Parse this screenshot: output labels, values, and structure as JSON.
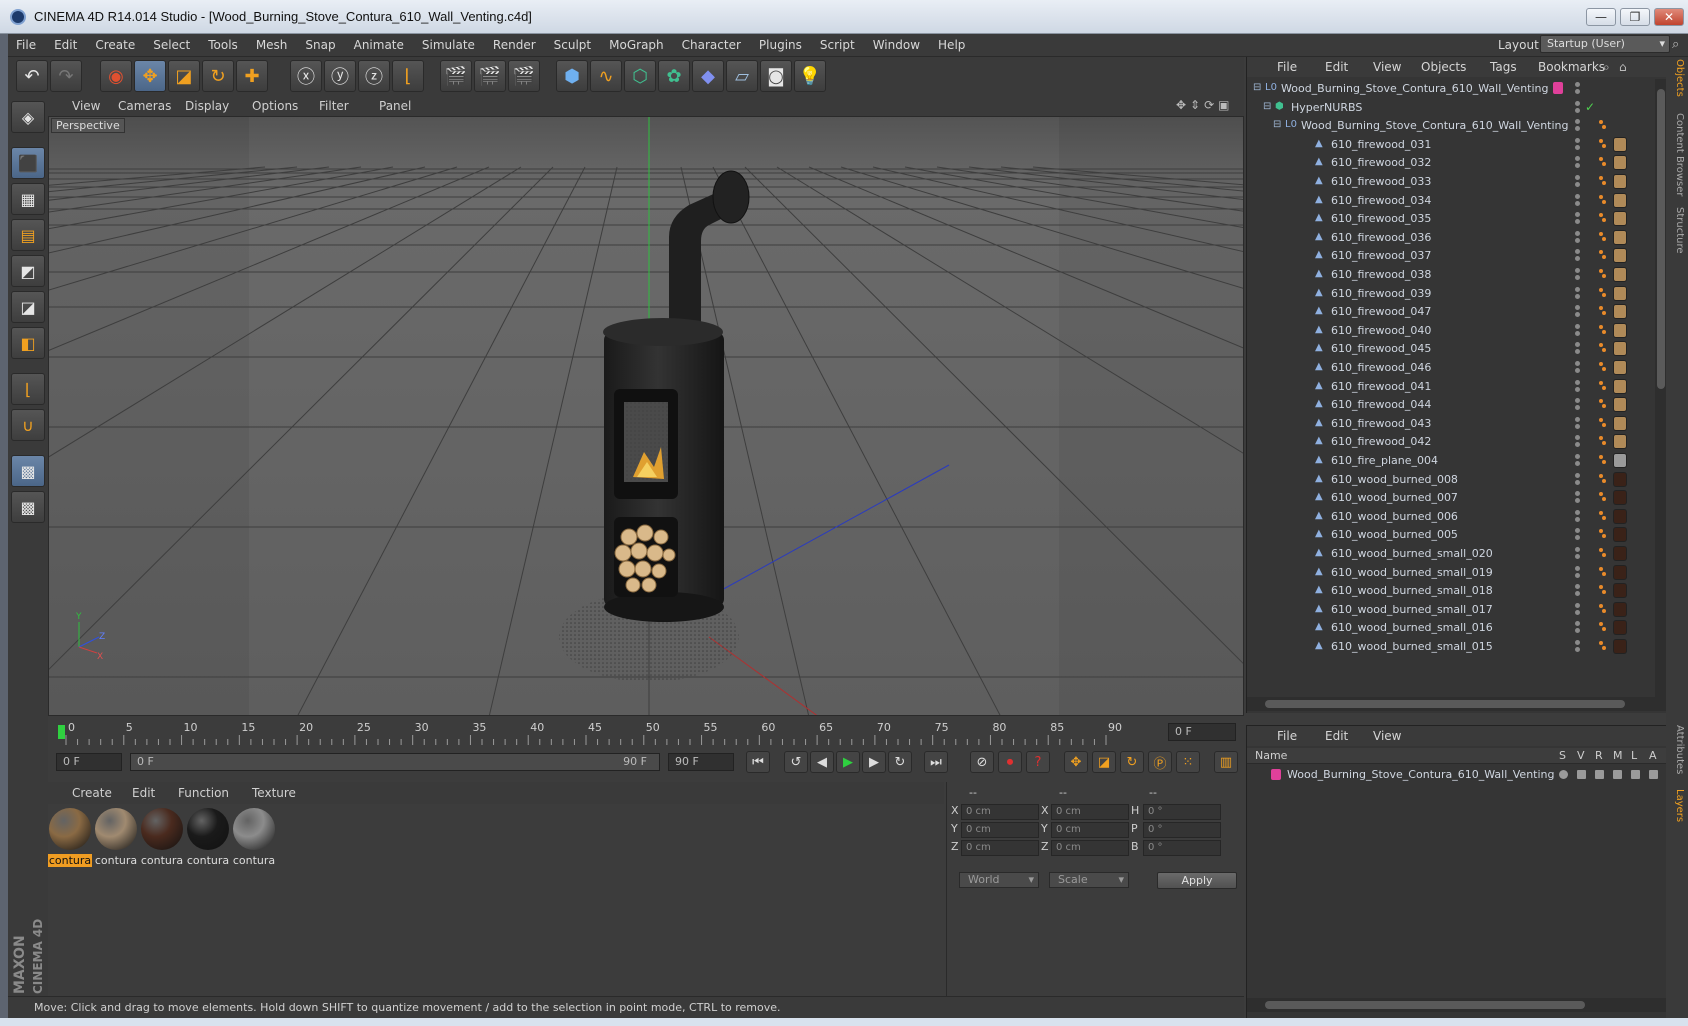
{
  "window": {
    "title": "CINEMA 4D R14.014 Studio - [Wood_Burning_Stove_Contura_610_Wall_Venting.c4d]",
    "minimize": "—",
    "maximize": "❐",
    "close": "✕"
  },
  "menubar": {
    "items": [
      "File",
      "Edit",
      "Create",
      "Select",
      "Tools",
      "Mesh",
      "Snap",
      "Animate",
      "Simulate",
      "Render",
      "Sculpt",
      "MoGraph",
      "Character",
      "Plugins",
      "Script",
      "Window",
      "Help"
    ],
    "layout_label": "Layout:",
    "layout_value": "Startup (User)"
  },
  "viewport": {
    "menu": [
      "View",
      "Cameras",
      "Display",
      "Options",
      "Filter",
      "Panel"
    ],
    "camera_label": "Perspective",
    "axis_y": "Y",
    "axis_x": "X",
    "axis_z": "Z"
  },
  "timeline": {
    "ticks": [
      "0",
      "5",
      "10",
      "15",
      "20",
      "25",
      "30",
      "35",
      "40",
      "45",
      "50",
      "55",
      "60",
      "65",
      "70",
      "75",
      "80",
      "85",
      "90"
    ],
    "current_frame": "0 F",
    "start_frame": "0 F",
    "range_start": "0 F",
    "range_end": "90 F",
    "end_frame": "90 F"
  },
  "material_manager": {
    "menu": [
      "Create",
      "Edit",
      "Function",
      "Texture"
    ],
    "materials": [
      {
        "label": "contura",
        "color": "#8a6a44",
        "selected": true
      },
      {
        "label": "contura",
        "color": "#a08a70",
        "selected": false
      },
      {
        "label": "contura",
        "color": "#4a2a1e",
        "selected": false
      },
      {
        "label": "contura",
        "color": "#1a1a1a",
        "selected": false
      },
      {
        "label": "contura",
        "color": "#8c8c8c",
        "selected": false
      }
    ]
  },
  "coordinates": {
    "headers": [
      "--",
      "--",
      "--"
    ],
    "rows": [
      {
        "a": "X",
        "av": "0 cm",
        "b": "X",
        "bv": "0 cm",
        "c": "H",
        "cv": "0 °"
      },
      {
        "a": "Y",
        "av": "0 cm",
        "b": "Y",
        "bv": "0 cm",
        "c": "P",
        "cv": "0 °"
      },
      {
        "a": "Z",
        "av": "0 cm",
        "b": "Z",
        "bv": "0 cm",
        "c": "B",
        "cv": "0 °"
      }
    ],
    "mode": "World",
    "transform": "Scale",
    "apply": "Apply"
  },
  "object_manager": {
    "menu": [
      "File",
      "Edit",
      "View",
      "Objects",
      "Tags",
      "Bookmarks"
    ],
    "rows": [
      {
        "name": "Wood_Burning_Stove_Contura_610_Wall_Venting",
        "level": 0,
        "type": "null",
        "tag": "pink"
      },
      {
        "name": "HyperNURBS",
        "level": 1,
        "type": "nurbs",
        "tag": "check"
      },
      {
        "name": "Wood_Burning_Stove_Contura_610_Wall_Venting",
        "level": 2,
        "type": "null",
        "tag": "none"
      },
      {
        "name": "610_firewood_031",
        "level": 3,
        "type": "poly",
        "tag": "wood"
      },
      {
        "name": "610_firewood_032",
        "level": 3,
        "type": "poly",
        "tag": "wood"
      },
      {
        "name": "610_firewood_033",
        "level": 3,
        "type": "poly",
        "tag": "wood"
      },
      {
        "name": "610_firewood_034",
        "level": 3,
        "type": "poly",
        "tag": "wood"
      },
      {
        "name": "610_firewood_035",
        "level": 3,
        "type": "poly",
        "tag": "wood"
      },
      {
        "name": "610_firewood_036",
        "level": 3,
        "type": "poly",
        "tag": "wood"
      },
      {
        "name": "610_firewood_037",
        "level": 3,
        "type": "poly",
        "tag": "wood"
      },
      {
        "name": "610_firewood_038",
        "level": 3,
        "type": "poly",
        "tag": "wood"
      },
      {
        "name": "610_firewood_039",
        "level": 3,
        "type": "poly",
        "tag": "wood"
      },
      {
        "name": "610_firewood_047",
        "level": 3,
        "type": "poly",
        "tag": "wood"
      },
      {
        "name": "610_firewood_040",
        "level": 3,
        "type": "poly",
        "tag": "wood"
      },
      {
        "name": "610_firewood_045",
        "level": 3,
        "type": "poly",
        "tag": "wood"
      },
      {
        "name": "610_firewood_046",
        "level": 3,
        "type": "poly",
        "tag": "wood"
      },
      {
        "name": "610_firewood_041",
        "level": 3,
        "type": "poly",
        "tag": "wood"
      },
      {
        "name": "610_firewood_044",
        "level": 3,
        "type": "poly",
        "tag": "wood"
      },
      {
        "name": "610_firewood_043",
        "level": 3,
        "type": "poly",
        "tag": "wood"
      },
      {
        "name": "610_firewood_042",
        "level": 3,
        "type": "poly",
        "tag": "wood"
      },
      {
        "name": "610_fire_plane_004",
        "level": 3,
        "type": "poly",
        "tag": "fire"
      },
      {
        "name": "610_wood_burned_008",
        "level": 3,
        "type": "poly",
        "tag": "burned"
      },
      {
        "name": "610_wood_burned_007",
        "level": 3,
        "type": "poly",
        "tag": "burned"
      },
      {
        "name": "610_wood_burned_006",
        "level": 3,
        "type": "poly",
        "tag": "burned"
      },
      {
        "name": "610_wood_burned_005",
        "level": 3,
        "type": "poly",
        "tag": "burned"
      },
      {
        "name": "610_wood_burned_small_020",
        "level": 3,
        "type": "poly",
        "tag": "burned"
      },
      {
        "name": "610_wood_burned_small_019",
        "level": 3,
        "type": "poly",
        "tag": "burned"
      },
      {
        "name": "610_wood_burned_small_018",
        "level": 3,
        "type": "poly",
        "tag": "burned"
      },
      {
        "name": "610_wood_burned_small_017",
        "level": 3,
        "type": "poly",
        "tag": "burned"
      },
      {
        "name": "610_wood_burned_small_016",
        "level": 3,
        "type": "poly",
        "tag": "burned"
      },
      {
        "name": "610_wood_burned_small_015",
        "level": 3,
        "type": "poly",
        "tag": "burned"
      }
    ]
  },
  "layer_manager": {
    "menu": [
      "File",
      "Edit",
      "View"
    ],
    "headers": {
      "name": "Name",
      "s": "S",
      "v": "V",
      "r": "R",
      "m": "M",
      "l": "L",
      "a": "A"
    },
    "layers": [
      {
        "name": "Wood_Burning_Stove_Contura_610_Wall_Venting",
        "color": "#e0409a"
      }
    ]
  },
  "side_tabs": {
    "top": [
      "Objects",
      "Content Browser",
      "Structure"
    ],
    "bottom": [
      "Attributes",
      "Layers"
    ]
  },
  "branding": {
    "line1": "MAXON",
    "line2": "CINEMA 4D"
  },
  "status": "Move: Click and drag to move elements. Hold down SHIFT to quantize movement / add to the selection in point mode, CTRL to remove.",
  "colors": {
    "accent": "#f09d22",
    "selection": "#5b7aa0",
    "layer_tag": "#e0409a"
  }
}
